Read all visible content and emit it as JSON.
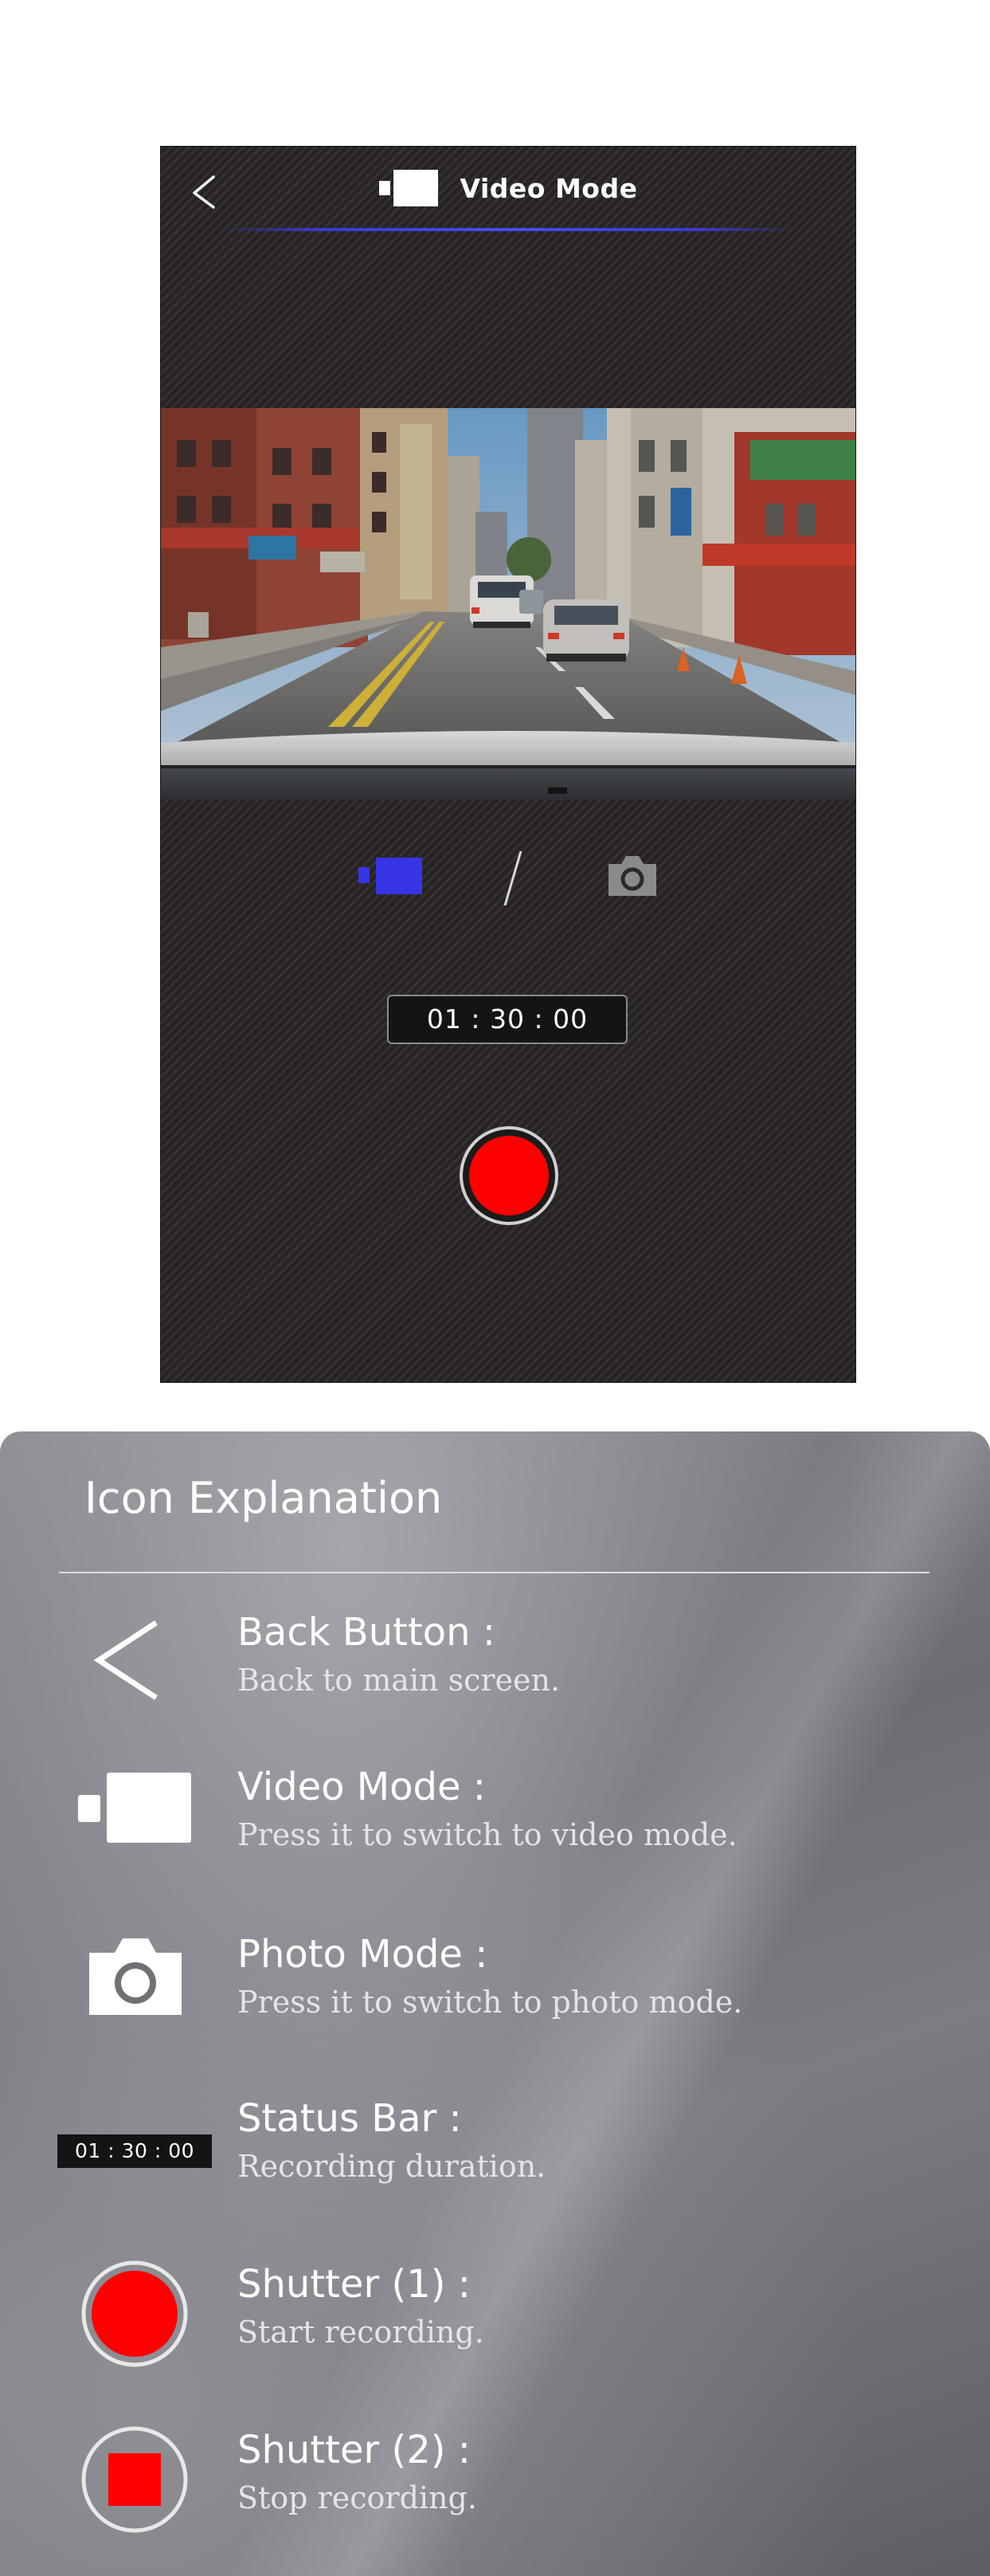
{
  "screen": {
    "title": "Video Mode",
    "status_time": "01 : 30 : 00",
    "icons": {
      "back": "chevron-left-icon",
      "title": "video-camera-icon",
      "mode_video": "video-camera-icon",
      "mode_photo": "camera-icon",
      "shutter": "record-button"
    },
    "colors": {
      "background": "#2c2827",
      "accent": "#3a3ad8",
      "active_mode": "#3535e6",
      "inactive_mode": "#8a8a8a",
      "record": "#ff0000"
    }
  },
  "legend": {
    "title": "Icon Explanation",
    "items": [
      {
        "name": "Back Button :",
        "desc": "Back to main screen.",
        "icon": "chevron-left-icon"
      },
      {
        "name": "Video Mode :",
        "desc": "Press it to switch to video mode.",
        "icon": "video-camera-icon"
      },
      {
        "name": "Photo Mode :",
        "desc": "Press it to switch to photo mode.",
        "icon": "camera-icon"
      },
      {
        "name": "Status Bar :",
        "desc": "Recording duration.",
        "icon": "status-bar",
        "sample": "01 : 30 : 00"
      },
      {
        "name": "Shutter (1) :",
        "desc": "Start recording.",
        "icon": "record-start-icon"
      },
      {
        "name": "Shutter (2) :",
        "desc": "Stop recording.",
        "icon": "record-stop-icon"
      }
    ]
  }
}
